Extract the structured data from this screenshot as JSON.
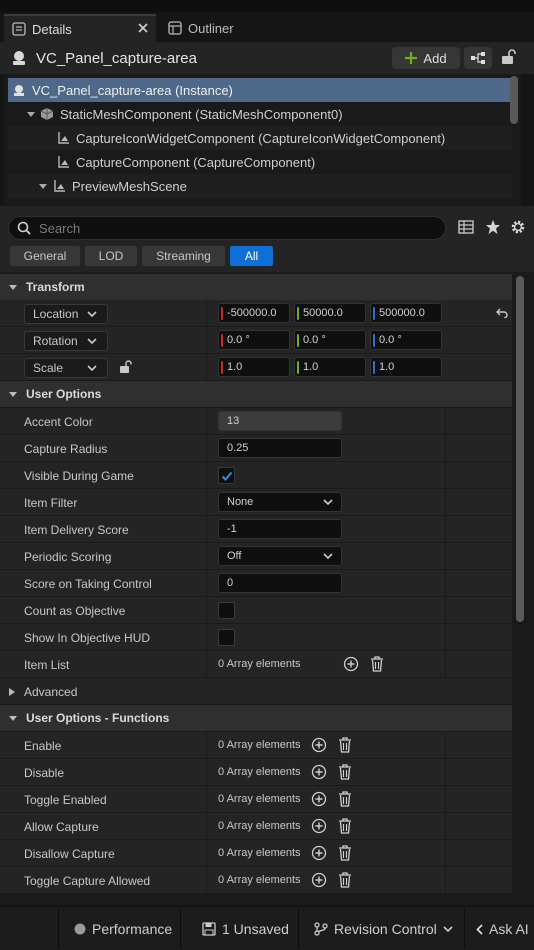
{
  "tabs": [
    {
      "label": "Details"
    },
    {
      "label": "Outliner"
    }
  ],
  "header": {
    "title": "VC_Panel_capture-area",
    "add_label": "Add"
  },
  "tree": [
    {
      "label": "VC_Panel_capture-area (Instance)"
    },
    {
      "label": "StaticMeshComponent (StaticMeshComponent0)"
    },
    {
      "label": "CaptureIconWidgetComponent (CaptureIconWidgetComponent)"
    },
    {
      "label": "CaptureComponent (CaptureComponent)"
    },
    {
      "label": "PreviewMeshScene"
    }
  ],
  "search": {
    "placeholder": "Search",
    "value": ""
  },
  "filters": [
    {
      "label": "General"
    },
    {
      "label": "LOD"
    },
    {
      "label": "Streaming"
    },
    {
      "label": "All"
    }
  ],
  "transform": {
    "title": "Transform",
    "location": {
      "label": "Location",
      "x": "-500000.0",
      "y": "50000.0",
      "z": "500000.0"
    },
    "rotation": {
      "label": "Rotation",
      "x": "0.0 °",
      "y": "0.0 °",
      "z": "0.0 °"
    },
    "scale": {
      "label": "Scale",
      "x": "1.0",
      "y": "1.0",
      "z": "1.0"
    }
  },
  "user_options": {
    "title": "User Options",
    "accent_color": {
      "label": "Accent Color",
      "value": "13"
    },
    "capture_radius": {
      "label": "Capture Radius",
      "value": "0.25"
    },
    "visible_during_game": {
      "label": "Visible During Game",
      "checked": true
    },
    "item_filter": {
      "label": "Item Filter",
      "value": "None"
    },
    "item_delivery_score": {
      "label": "Item Delivery Score",
      "value": "-1"
    },
    "periodic_scoring": {
      "label": "Periodic Scoring",
      "value": "Off"
    },
    "score_on_taking_control": {
      "label": "Score on Taking Control",
      "value": "0"
    },
    "count_as_objective": {
      "label": "Count as Objective",
      "checked": false
    },
    "show_in_objective_hud": {
      "label": "Show In Objective HUD",
      "checked": false
    },
    "item_list": {
      "label": "Item List",
      "value": "0 Array elements"
    }
  },
  "advanced": {
    "label": "Advanced"
  },
  "functions": {
    "title": "User Options - Functions",
    "items": [
      {
        "label": "Enable",
        "value": "0 Array elements"
      },
      {
        "label": "Disable",
        "value": "0 Array elements"
      },
      {
        "label": "Toggle Enabled",
        "value": "0 Array elements"
      },
      {
        "label": "Allow Capture",
        "value": "0 Array elements"
      },
      {
        "label": "Disallow Capture",
        "value": "0 Array elements"
      },
      {
        "label": "Toggle Capture Allowed",
        "value": "0 Array elements"
      }
    ]
  },
  "statusbar": {
    "performance": "Performance",
    "unsaved": "1 Unsaved",
    "revision": "Revision Control",
    "ask_ai": "Ask AI"
  },
  "colors": {
    "accent": "#0e6fd6",
    "selection": "#4d6888",
    "add_plus": "#6cb01e"
  }
}
